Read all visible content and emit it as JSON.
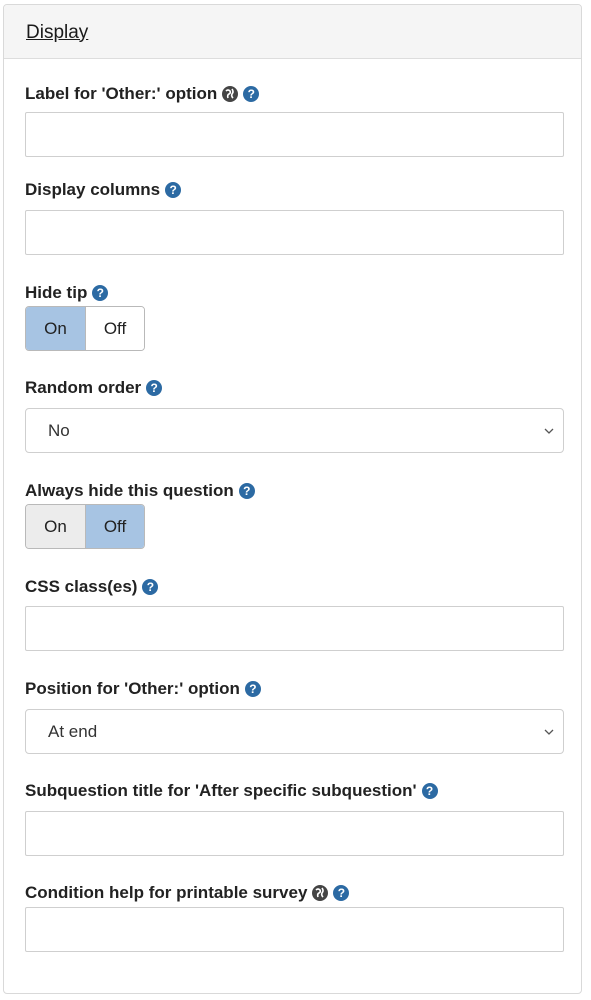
{
  "panel": {
    "title": "Display"
  },
  "fields": {
    "other_label": {
      "label": "Label for 'Other:' option",
      "value": ""
    },
    "display_columns": {
      "label": "Display columns",
      "value": ""
    },
    "hide_tip": {
      "label": "Hide tip",
      "on_label": "On",
      "off_label": "Off",
      "selected": "On"
    },
    "random_order": {
      "label": "Random order",
      "selected": "No"
    },
    "always_hide": {
      "label": "Always hide this question",
      "on_label": "On",
      "off_label": "Off",
      "selected": "Off"
    },
    "css_classes": {
      "label": "CSS class(es)",
      "value": ""
    },
    "other_position": {
      "label": "Position for 'Other:' option",
      "selected": "At end"
    },
    "subquestion_title": {
      "label": "Subquestion title for 'After specific subquestion'",
      "value": ""
    },
    "condition_help": {
      "label": "Condition help for printable survey",
      "value": ""
    }
  },
  "colors": {
    "help_icon": "#2c6aa3",
    "toggle_active": "#a7c4e3",
    "globe_icon": "#444444"
  },
  "icons": [
    "globe-icon",
    "help-icon",
    "chevron-down-icon"
  ]
}
